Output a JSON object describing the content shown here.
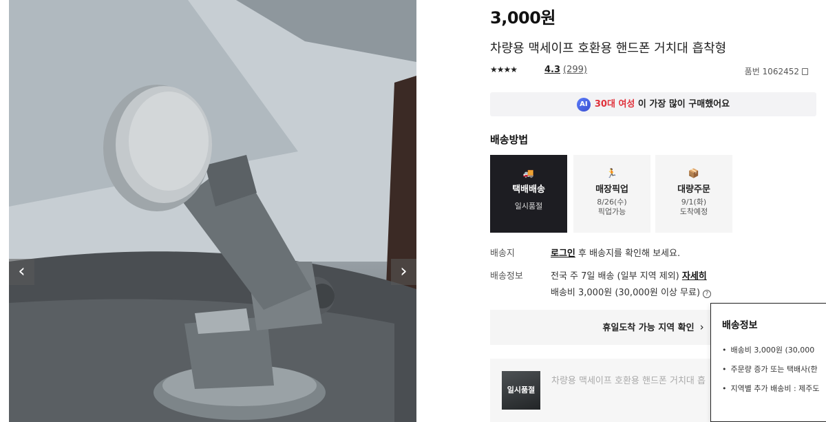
{
  "gallery": {
    "prev_arrow": "‹",
    "next_arrow": "›"
  },
  "product": {
    "price": "3,000원",
    "title": "차량용 맥세이프 호환용 핸드폰 거치대 흡착형",
    "stars": "★★★★",
    "rating": "4.3",
    "review_count": "(299)",
    "sku": "품번 1062452"
  },
  "ai_banner": {
    "badge": "AI",
    "highlight": "30대 여성",
    "rest": " 이 가장 많이 구매했어요"
  },
  "shipping": {
    "heading": "배송방법",
    "cards": [
      {
        "icon": "delivery-truck-icon",
        "glyph": "🚚",
        "label": "택배배송",
        "sub1": "일시품절",
        "sub2": ""
      },
      {
        "icon": "pickup-runner-icon",
        "glyph": "🏃",
        "label": "매장픽업",
        "sub1": "8/26(수)",
        "sub2": "픽업가능"
      },
      {
        "icon": "bulk-box-icon",
        "glyph": "📦",
        "label": "대량주문",
        "sub1": "9/1(화)",
        "sub2": "도착예정"
      }
    ],
    "destination_label": "배송지",
    "login_link": "로그인",
    "destination_text": " 후 배송지를 확인해 보세요.",
    "info_label": "배송정보",
    "info_text": "전국 주 7일 배송 (일부 지역 제외)",
    "detail_link": "자세히",
    "fee_text": "배송비 3,000원 (30,000원 이상 무료)",
    "help_glyph": "?",
    "holiday_button": "휴일도착 가능 지역 확인",
    "holiday_chevron": "›"
  },
  "mini_bar": {
    "soldout": "일시품절",
    "title": "차량용 맥세이프 호환용 핸드폰 거치대 흡"
  },
  "tooltip": {
    "title": "배송정보",
    "items": [
      "배송비 3,000원 (30,000",
      "주문량 증가 또는 택배사(한",
      "지역별 추가 배송비 : 제주도"
    ]
  },
  "colors": {
    "accent_red": "#e0303a",
    "selected_card": "#1d1d22",
    "panel_bg": "#f5f5f5"
  }
}
